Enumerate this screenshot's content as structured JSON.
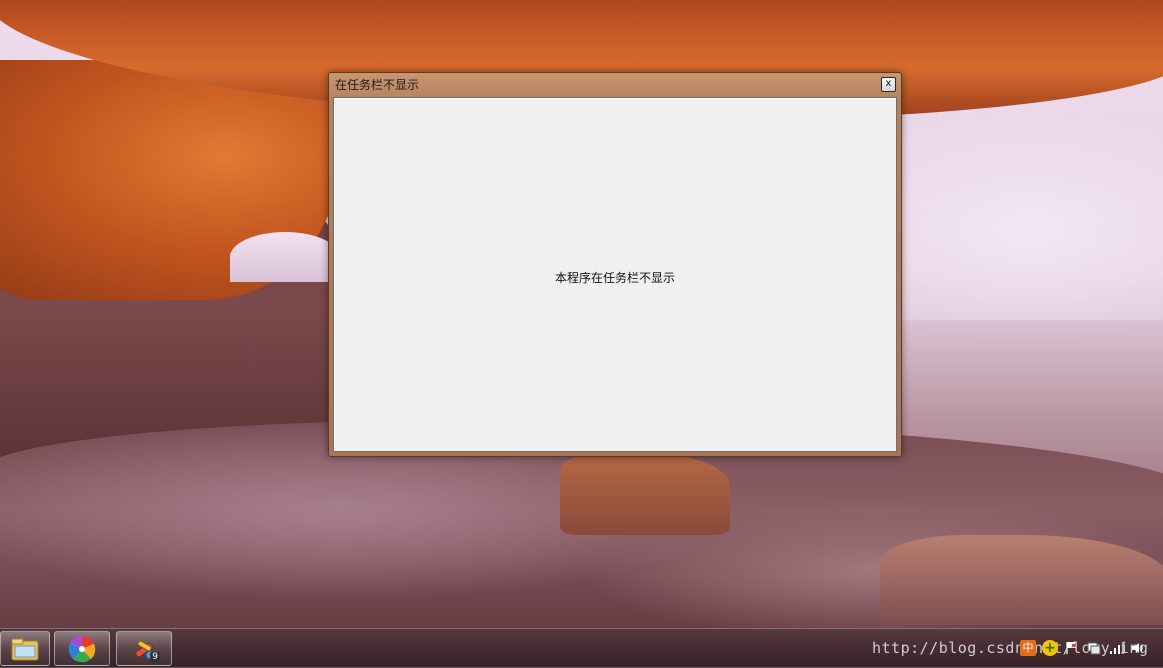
{
  "window": {
    "title": "在任务栏不显示",
    "close_label": "x",
    "body_text": "本程序在任务栏不显示"
  },
  "taskbar": {
    "apps": [
      {
        "name": "explorer",
        "icon": "folder-icon"
      },
      {
        "name": "media-center",
        "icon": "media-center-icon"
      },
      {
        "name": "paint-app",
        "icon": "paint-icon",
        "badge": "9"
      }
    ],
    "watermark": "http://blog.csdn.net/lory.ing",
    "tray": {
      "ime": "中",
      "icons": [
        "plus-icon",
        "flag-icon",
        "network-icon",
        "signal-icon",
        "volume-icon"
      ]
    }
  },
  "colors": {
    "window_frame": "#b67f5c",
    "client_bg": "#f0f0f0",
    "ime_orange": "#e56a1a"
  }
}
